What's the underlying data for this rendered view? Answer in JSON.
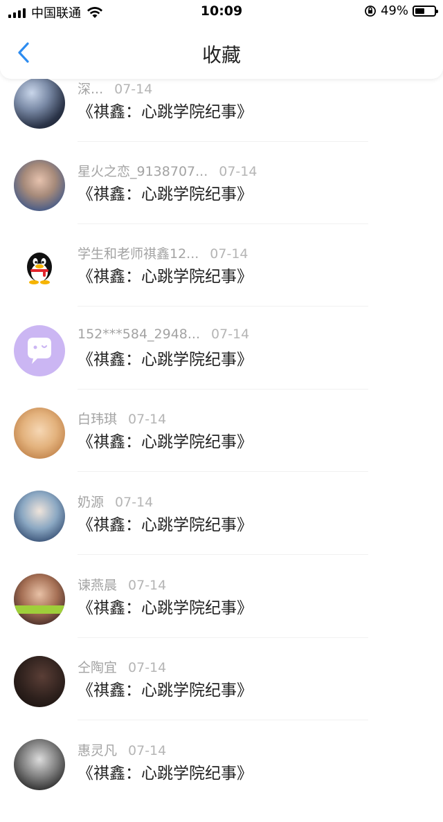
{
  "status_bar": {
    "carrier": "中国联通",
    "time": "10:09",
    "battery": "49%",
    "battery_level": 0.49
  },
  "nav": {
    "title": "收藏"
  },
  "favorites": [
    {
      "name": "深...",
      "date": "07-14",
      "title": "《祺鑫：心跳学院纪事》"
    },
    {
      "name": "星火之恋_9138707...",
      "date": "07-14",
      "title": "《祺鑫：心跳学院纪事》"
    },
    {
      "name": "学生和老师祺鑫12...",
      "date": "07-14",
      "title": "《祺鑫：心跳学院纪事》"
    },
    {
      "name": "152***584_2948...",
      "date": "07-14",
      "title": "《祺鑫：心跳学院纪事》"
    },
    {
      "name": "白玮琪",
      "date": "07-14",
      "title": "《祺鑫：心跳学院纪事》"
    },
    {
      "name": "奶源",
      "date": "07-14",
      "title": "《祺鑫：心跳学院纪事》"
    },
    {
      "name": "谏燕晨",
      "date": "07-14",
      "title": "《祺鑫：心跳学院纪事》"
    },
    {
      "name": "仝陶宜",
      "date": "07-14",
      "title": "《祺鑫：心跳学院纪事》"
    },
    {
      "name": "惠灵凡",
      "date": "07-14",
      "title": "《祺鑫：心跳学院纪事》"
    }
  ],
  "colors": {
    "back_arrow": "#2d8cf0",
    "name_gray": "#a3a3a3",
    "title_dark": "#222222"
  }
}
